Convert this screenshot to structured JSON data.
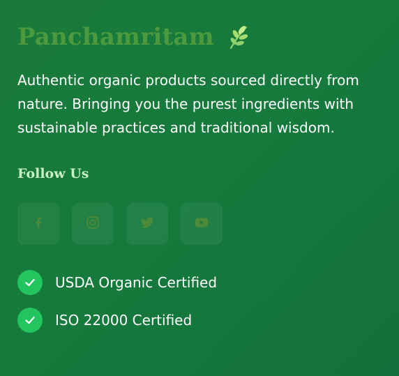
{
  "brand": {
    "name": "Panchamritam",
    "icon": "leaf-icon"
  },
  "about": {
    "description": "Authentic organic products sourced directly from nature. Bringing you the purest ingredients with sustainable practices and traditional wisdom."
  },
  "social": {
    "heading": "Follow Us",
    "links": [
      {
        "icon": "facebook-icon"
      },
      {
        "icon": "instagram-icon"
      },
      {
        "icon": "twitter-icon"
      },
      {
        "icon": "youtube-icon"
      }
    ]
  },
  "certifications": [
    {
      "label": "USDA Organic Certified",
      "icon": "check-icon"
    },
    {
      "label": "ISO 22000 Certified",
      "icon": "check-icon"
    }
  ],
  "colors": {
    "background": "#157a3c",
    "brand_text": "#4d9a3e",
    "heading": "#c8f0c8",
    "check": "#22c55e",
    "social_icon": "#4d8a3a"
  }
}
